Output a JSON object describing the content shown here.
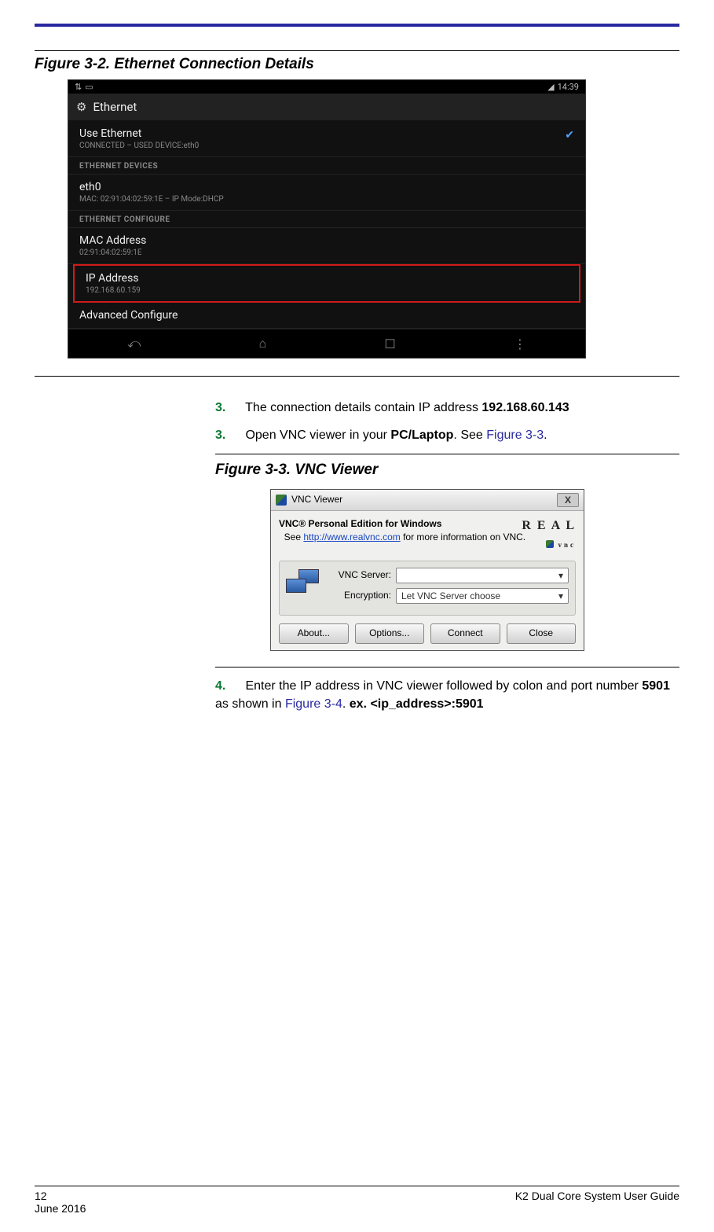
{
  "figure32": {
    "caption": "Figure 3-2. Ethernet Connection Details",
    "statusbar": {
      "time": "14:39"
    },
    "header": "Ethernet",
    "useEthernet": {
      "title": "Use Ethernet",
      "sub": "CONNECTED – USED DEVICE:eth0"
    },
    "sectionDevices": "ETHERNET DEVICES",
    "eth0": {
      "title": "eth0",
      "sub": "MAC: 02:91:04:02:59:1E – IP Mode:DHCP"
    },
    "sectionConfigure": "ETHERNET CONFIGURE",
    "mac": {
      "title": "MAC Address",
      "sub": "02:91:04:02:59:1E"
    },
    "ip": {
      "title": "IP Address",
      "sub": "192.168.60.159"
    },
    "advanced": "Advanced Configure"
  },
  "instr": {
    "s3a_num": "3.",
    "s3a_text_prefix": "The connection details contain IP address ",
    "s3a_ip": "192.168.60.143",
    "s3b_num": "3.",
    "s3b_text_prefix": "Open VNC viewer in your ",
    "s3b_bold": "PC/Laptop",
    "s3b_text_mid": ". See ",
    "s3b_link": "Figure 3-3",
    "s3b_text_suffix": "."
  },
  "figure33": {
    "caption": "Figure 3-3.  VNC Viewer",
    "winTitle": "VNC Viewer",
    "pe_head": "VNC® Personal Edition for Windows",
    "pe_see": "See ",
    "pe_url": "http://www.realvnc.com",
    "pe_tail": " for more information on VNC.",
    "real_top": "R E A L",
    "real_sub": "vnc",
    "lblServer": "VNC Server:",
    "lblEnc": "Encryption:",
    "encValue": "Let VNC Server choose",
    "btnAbout": "About...",
    "btnOptions": "Options...",
    "btnConnect": "Connect",
    "btnClose": "Close"
  },
  "instr4": {
    "num": "4.",
    "t1": "Enter the IP address in VNC viewer followed by colon and port number ",
    "bold1": "5901",
    "t2": " as shown in ",
    "link": "Figure 3-4",
    "t3": ".  ",
    "bold2": "ex. <ip_address>:5901"
  },
  "footer": {
    "pageNum": "12",
    "date": "June 2016",
    "guide": "K2 Dual Core System User Guide"
  }
}
